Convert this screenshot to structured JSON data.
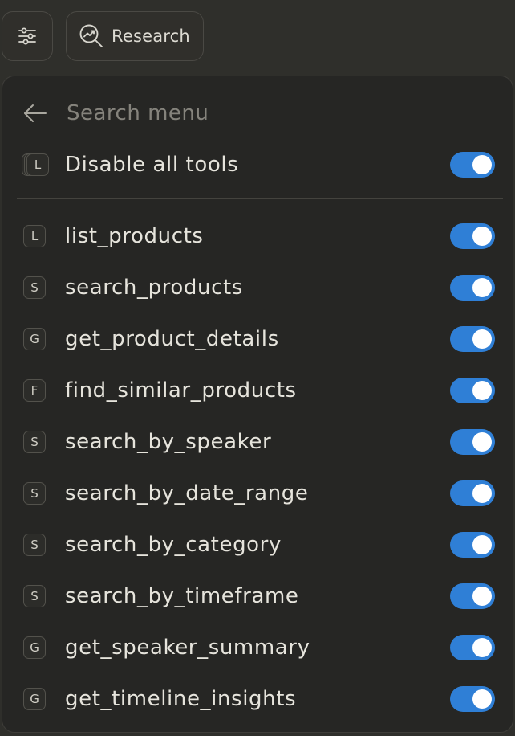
{
  "toolbar": {
    "filter_icon": "sliders-icon",
    "research_label": "Research",
    "research_icon": "magnify-chart-icon"
  },
  "search": {
    "placeholder": "Search menu",
    "back_icon": "arrow-left-icon"
  },
  "disable_all": {
    "badge": "L",
    "label": "Disable all tools",
    "enabled": true
  },
  "accent": "#2f7fd6",
  "tools": [
    {
      "badge": "L",
      "label": "list_products",
      "enabled": true
    },
    {
      "badge": "S",
      "label": "search_products",
      "enabled": true
    },
    {
      "badge": "G",
      "label": "get_product_details",
      "enabled": true
    },
    {
      "badge": "F",
      "label": "find_similar_products",
      "enabled": true
    },
    {
      "badge": "S",
      "label": "search_by_speaker",
      "enabled": true
    },
    {
      "badge": "S",
      "label": "search_by_date_range",
      "enabled": true
    },
    {
      "badge": "S",
      "label": "search_by_category",
      "enabled": true
    },
    {
      "badge": "S",
      "label": "search_by_timeframe",
      "enabled": true
    },
    {
      "badge": "G",
      "label": "get_speaker_summary",
      "enabled": true
    },
    {
      "badge": "G",
      "label": "get_timeline_insights",
      "enabled": true
    }
  ]
}
